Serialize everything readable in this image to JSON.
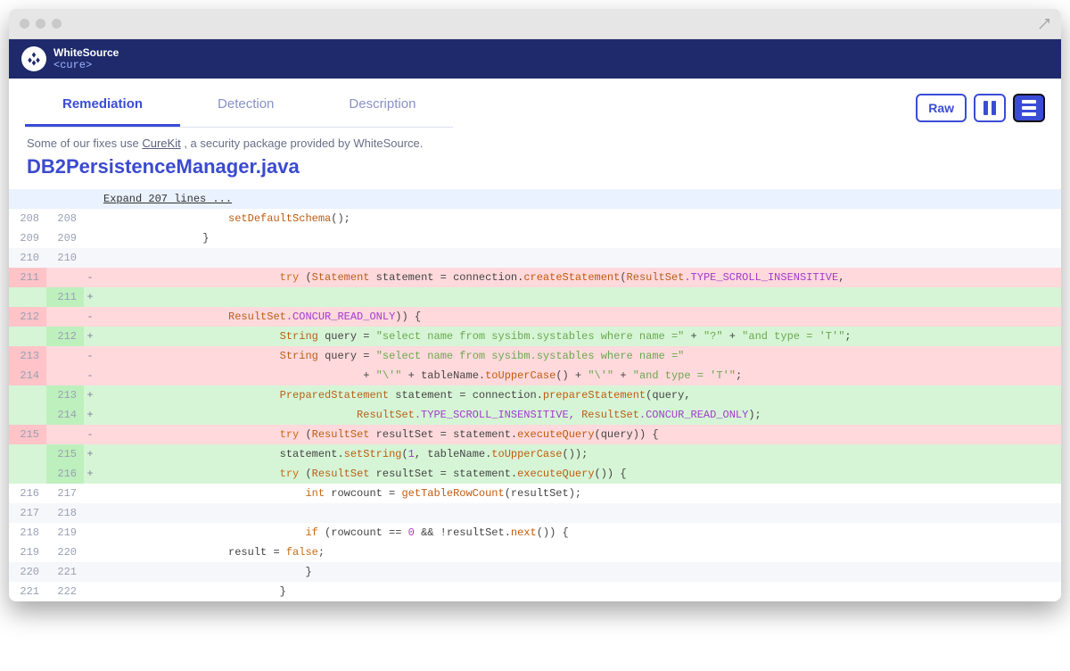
{
  "brand": {
    "name": "WhiteSource",
    "sub": "<cure>"
  },
  "tabs": {
    "remediation": "Remediation",
    "detection": "Detection",
    "description": "Description"
  },
  "toolbar": {
    "raw": "Raw"
  },
  "note": {
    "prefix": "Some of our fixes use ",
    "link": "CureKit",
    "suffix": " , a security package provided by WhiteSource."
  },
  "filename": "DB2PersistenceManager.java",
  "expand": "Expand 207 lines ...",
  "seg": {
    "setDefault": "setDefaultSchema",
    "pclose": "();",
    "brace_close": "}",
    "try": "try",
    "openp": " (",
    "stmt": "Statement",
    "sp": " ",
    "var_stmt": "statement",
    "eq": " = ",
    "conn": "connection",
    "dot": ".",
    "createStmt": "createStatement",
    "op": "(",
    "rs": "ResultSet",
    "tsi": ".TYPE_SCROLL_INSENSITIVE",
    "comma": ",",
    "cro": ".CONCUR_READ_ONLY",
    "close_brace": ")) {",
    "str_t": "String",
    "query": "query",
    "q1": "\"select name from sysibm.systables where name =\"",
    "plus": " + ",
    "qm": "\"?\"",
    "q2": "\"and type = 'T'\"",
    "semi": ";",
    "q3": "\"select name from sysibm.systables where name =\"",
    "esc": "\"\\'\"",
    "tname": "tableName",
    "toUpper": "toUpperCase",
    "paren": "()",
    "prep_t": "PreparedStatement",
    "prep": "prepareStatement",
    "q": "query",
    "c2": ",",
    "tsi2": ".TYPE_SCROLL_INSENSITIVE, ",
    "cro2": ".CONCUR_READ_ONLY",
    "closeP": ");",
    "rsvar": "resultSet",
    "exq": "executeQuery",
    "tail_q": ")) {",
    "tail_e": "()) {",
    "setStr": "setString",
    "one": "1",
    "c": ", ",
    "int": "int",
    "rc": "rowcount",
    "gtrc": "getTableRowCount",
    "if": "if",
    "cond_open": " (rowcount == ",
    "zero": "0",
    "cond_mid": " && !",
    "next": "next",
    "cond_close": "()) {",
    "resf": "result = ",
    "false": "false"
  },
  "lines": [
    {
      "t": "ctx",
      "o": "208",
      "n": "208"
    },
    {
      "t": "ctx",
      "o": "209",
      "n": "209"
    },
    {
      "t": "alt",
      "o": "210",
      "n": "210"
    },
    {
      "t": "del",
      "o": "211",
      "n": ""
    },
    {
      "t": "add",
      "o": "",
      "n": "211"
    },
    {
      "t": "del",
      "o": "212",
      "n": ""
    },
    {
      "t": "add",
      "o": "",
      "n": "212"
    },
    {
      "t": "del",
      "o": "213",
      "n": ""
    },
    {
      "t": "del",
      "o": "214",
      "n": ""
    },
    {
      "t": "add",
      "o": "",
      "n": "213"
    },
    {
      "t": "add",
      "o": "",
      "n": "214"
    },
    {
      "t": "del",
      "o": "215",
      "n": ""
    },
    {
      "t": "add",
      "o": "",
      "n": "215"
    },
    {
      "t": "add",
      "o": "",
      "n": "216"
    },
    {
      "t": "ctx",
      "o": "216",
      "n": "217"
    },
    {
      "t": "alt",
      "o": "217",
      "n": "218"
    },
    {
      "t": "ctx",
      "o": "218",
      "n": "219"
    },
    {
      "t": "ctx",
      "o": "219",
      "n": "220"
    },
    {
      "t": "alt",
      "o": "220",
      "n": "221"
    },
    {
      "t": "ctx",
      "o": "221",
      "n": "222"
    }
  ]
}
